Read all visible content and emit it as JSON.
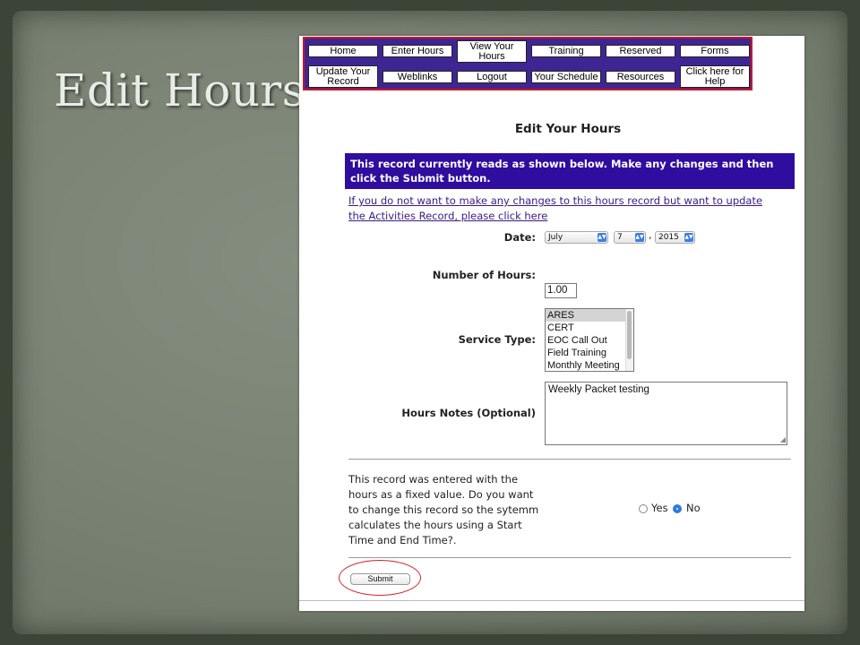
{
  "slide": {
    "title": "Edit Hours:"
  },
  "nav": {
    "buttons": [
      "Home",
      "Enter Hours",
      "View Your Hours",
      "Training",
      "Reserved",
      "Forms",
      "Update Your Record",
      "Weblinks",
      "Logout",
      "Your Schedule",
      "Resources",
      "Click here for Help"
    ]
  },
  "page": {
    "heading": "Edit Your Hours",
    "banner": "This record currently reads as shown below. Make any changes and then click the Submit button.",
    "link": "If you do not want to make any changes to this hours record but want to update the Activities Record, please click here"
  },
  "form": {
    "date_label": "Date:",
    "month": "July",
    "day": "7",
    "year": "2015",
    "comma": ",",
    "hours_label": "Number of Hours:",
    "hours_value": "1.00",
    "service_label": "Service Type:",
    "service_options": [
      "ARES",
      "CERT",
      "EOC Call Out",
      "Field Training",
      "Monthly Meeting"
    ],
    "service_selected": "ARES",
    "notes_label": "Hours Notes (Optional)",
    "notes_value": "Weekly Packet testing",
    "question": "This record was entered with the hours as a fixed value. Do you want to change this record so the sytemm calculates the hours using a Start Time and End Time?.",
    "yes_label": "Yes",
    "no_label": "No",
    "selected_option": "No",
    "submit_label": "Submit"
  },
  "colors": {
    "nav_bg": "#3f2594",
    "nav_border": "#d0141e",
    "banner_bg": "#2e0d9f",
    "link": "#3a1a86",
    "highlight_circle": "#d8202c"
  }
}
